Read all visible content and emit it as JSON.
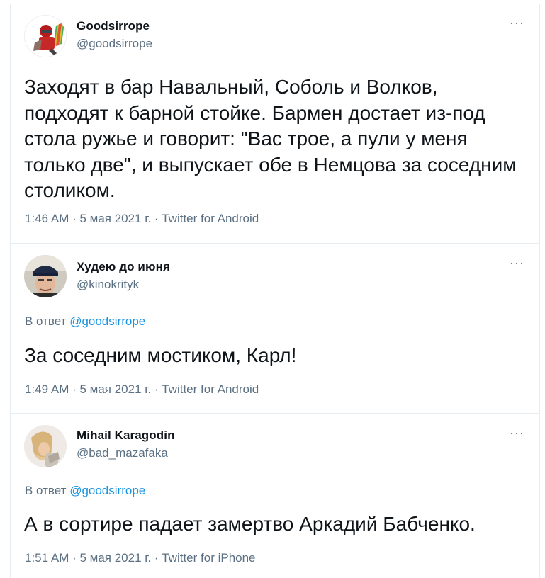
{
  "tweets": [
    {
      "name": "Goodsirrope",
      "handle": "@goodsirrope",
      "text": "Заходят в бар Навальный, Соболь и Волков, подходят к барной стойке. Бармен достает из-под стола ружье и говорит: \"Вас трое, а пули у меня только две\", и выпускает обе в Немцова за соседним столиком.",
      "meta": "1:46 AM · 5 мая 2021 г. · Twitter for Android",
      "more": "···"
    },
    {
      "name": "Худею до июня",
      "handle": "@kinokrityk",
      "reply_prefix": "В ответ",
      "reply_to": "@goodsirrope",
      "text": "За соседним мостиком, Карл!",
      "meta": "1:49 AM · 5 мая 2021 г. · Twitter for Android",
      "more": "···"
    },
    {
      "name": "Mihail Karagodin",
      "handle": "@bad_mazafaka",
      "reply_prefix": "В ответ",
      "reply_to": "@goodsirrope",
      "text": "А в сортире падает замертво Аркадий Бабченко.",
      "meta": "1:51 AM · 5 мая 2021 г. · Twitter for iPhone",
      "more": "···"
    }
  ],
  "colors": {
    "text": "#0f1419",
    "secondary": "#5b7083",
    "link": "#1b95e0",
    "divider": "#e6ecf0"
  },
  "icons": {
    "more": "more-icon",
    "avatar1": "avatar-icon",
    "avatar2": "avatar-icon",
    "avatar3": "avatar-icon"
  }
}
